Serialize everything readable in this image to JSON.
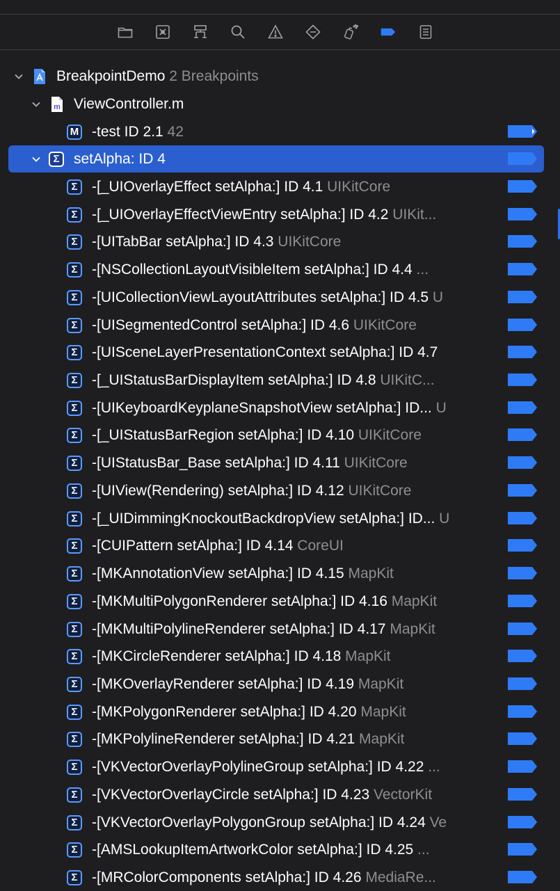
{
  "toolbar": {
    "icons": [
      "folder-icon",
      "source-control-icon",
      "hierarchy-icon",
      "search-icon",
      "warning-icon",
      "test-diamond-icon",
      "debug-spray-icon",
      "breakpoint-tag-icon",
      "report-list-icon"
    ]
  },
  "project": {
    "name": "BreakpointDemo",
    "count": "2 Breakpoints"
  },
  "file": {
    "name": "ViewController.m"
  },
  "test_bp": {
    "name": "-test  ID 2.1",
    "line": "42"
  },
  "group": {
    "name": "setAlpha: ID 4"
  },
  "children": [
    {
      "main": "-[_UIOverlayEffect setAlpha:]  ID 4.1",
      "sub": " UIKitCore"
    },
    {
      "main": "-[_UIOverlayEffectViewEntry setAlpha:]  ID 4.2",
      "sub": " UIKit..."
    },
    {
      "main": "-[UITabBar setAlpha:]  ID 4.3",
      "sub": " UIKitCore"
    },
    {
      "main": "-[NSCollectionLayoutVisibleItem setAlpha:]  ID 4.4",
      "sub": " ..."
    },
    {
      "main": "-[UICollectionViewLayoutAttributes setAlpha:]  ID 4.5",
      "sub": " U"
    },
    {
      "main": "-[UISegmentedControl setAlpha:]  ID 4.6",
      "sub": " UIKitCore"
    },
    {
      "main": "-[UISceneLayerPresentationContext setAlpha:]  ID 4.7",
      "sub": ""
    },
    {
      "main": "-[_UIStatusBarDisplayItem setAlpha:]  ID 4.8",
      "sub": " UIKitC..."
    },
    {
      "main": "-[UIKeyboardKeyplaneSnapshotView setAlpha:]  ID...",
      "sub": " U"
    },
    {
      "main": "-[_UIStatusBarRegion setAlpha:]  ID 4.10",
      "sub": " UIKitCore"
    },
    {
      "main": "-[UIStatusBar_Base setAlpha:]  ID 4.11",
      "sub": " UIKitCore"
    },
    {
      "main": "-[UIView(Rendering) setAlpha:]  ID 4.12",
      "sub": " UIKitCore"
    },
    {
      "main": "-[_UIDimmingKnockoutBackdropView setAlpha:]  ID...",
      "sub": " U"
    },
    {
      "main": "-[CUIPattern setAlpha:]  ID 4.14",
      "sub": " CoreUI"
    },
    {
      "main": "-[MKAnnotationView setAlpha:]  ID 4.15",
      "sub": " MapKit"
    },
    {
      "main": "-[MKMultiPolygonRenderer setAlpha:]  ID 4.16",
      "sub": " MapKit"
    },
    {
      "main": "-[MKMultiPolylineRenderer setAlpha:]  ID 4.17",
      "sub": " MapKit"
    },
    {
      "main": "-[MKCircleRenderer setAlpha:]  ID 4.18",
      "sub": " MapKit"
    },
    {
      "main": "-[MKOverlayRenderer setAlpha:]  ID 4.19",
      "sub": " MapKit"
    },
    {
      "main": "-[MKPolygonRenderer setAlpha:]  ID 4.20",
      "sub": " MapKit"
    },
    {
      "main": "-[MKPolylineRenderer setAlpha:]  ID 4.21",
      "sub": " MapKit"
    },
    {
      "main": "-[VKVectorOverlayPolylineGroup setAlpha:]  ID 4.22",
      "sub": " ..."
    },
    {
      "main": "-[VKVectorOverlayCircle setAlpha:]  ID 4.23",
      "sub": " VectorKit"
    },
    {
      "main": "-[VKVectorOverlayPolygonGroup setAlpha:]  ID 4.24",
      "sub": " Ve"
    },
    {
      "main": "-[AMSLookupItemArtworkColor setAlpha:]  ID 4.25",
      "sub": " ..."
    },
    {
      "main": "-[MRColorComponents setAlpha:]  ID 4.26",
      "sub": " MediaRe..."
    }
  ],
  "colors": {
    "background": "#1e1e20",
    "selection": "#2b5fcf",
    "breakpoint": "#2f7bf6",
    "secondary_text": "#8e8e93"
  }
}
